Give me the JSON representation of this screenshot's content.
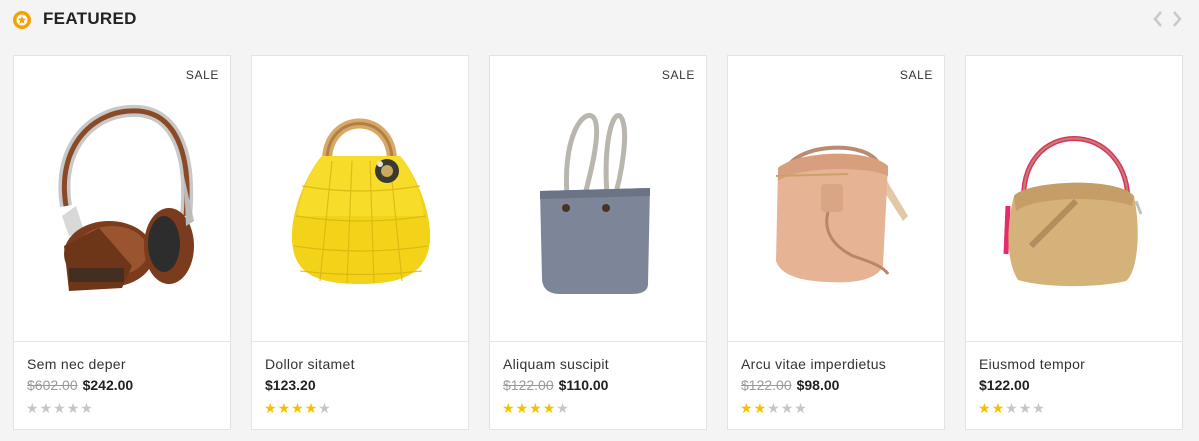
{
  "section": {
    "title": "FEATURED",
    "accent_color": "#f5a100",
    "icon": "badge-star-icon",
    "nav": {
      "prev_icon": "chevron-left-icon",
      "next_icon": "chevron-right-icon"
    }
  },
  "products": [
    {
      "name": "Sem nec deper",
      "sale_label": "SALE",
      "old_price": "$602.00",
      "price": "$242.00",
      "rating": 0,
      "rating_max": 5,
      "image_icon": "headphones-image"
    },
    {
      "name": "Dollor sitamet",
      "sale_label": "",
      "old_price": "",
      "price": "$123.20",
      "rating": 4,
      "rating_max": 5,
      "image_icon": "yellow-knit-bag-image"
    },
    {
      "name": "Aliquam suscipit",
      "sale_label": "SALE",
      "old_price": "$122.00",
      "price": "$110.00",
      "rating": 4,
      "rating_max": 5,
      "image_icon": "grey-tote-bag-image"
    },
    {
      "name": "Arcu vitae imperdietus",
      "sale_label": "SALE",
      "old_price": "$122.00",
      "price": "$98.00",
      "rating": 2,
      "rating_max": 5,
      "image_icon": "peach-bucket-bag-image"
    },
    {
      "name": "Eiusmod tempor",
      "sale_label": "",
      "old_price": "",
      "price": "$122.00",
      "rating": 2,
      "rating_max": 5,
      "image_icon": "tan-hobo-bag-image"
    }
  ]
}
